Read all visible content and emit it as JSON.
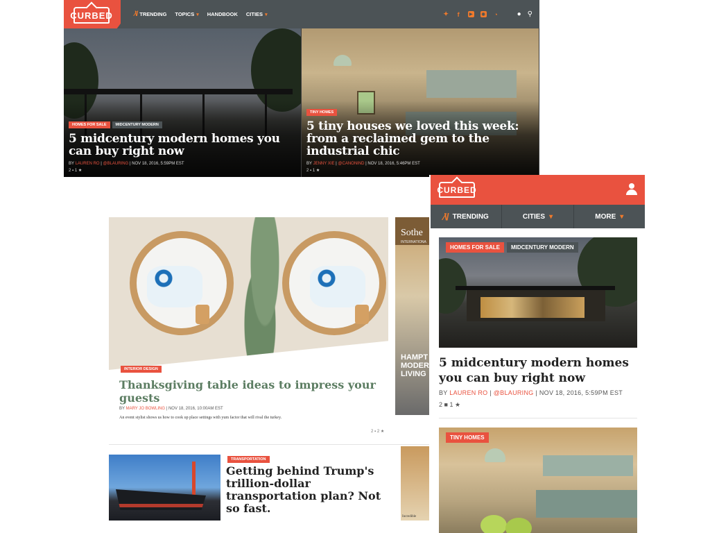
{
  "desktop": {
    "logo": "CURBED",
    "nav": [
      {
        "label": "TRENDING",
        "icon": "trending-icon"
      },
      {
        "label": "TOPICS",
        "icon": "caret-down-icon"
      },
      {
        "label": "HANDBOOK"
      },
      {
        "label": "CITIES",
        "icon": "caret-down-icon"
      }
    ],
    "social_icons": [
      "twitter-icon",
      "facebook-icon",
      "youtube-icon",
      "instagram-icon",
      "rss-icon"
    ],
    "utility_icons": [
      "user-icon",
      "search-icon"
    ],
    "stories": [
      {
        "tags": [
          "HOMES FOR SALE",
          "MIDCENTURY MODERN"
        ],
        "title": "5 midcentury modern homes you can buy right now",
        "by": "BY",
        "author": "LAUREN RO",
        "handle": "@BLAURING",
        "date": "NOV 18, 2016, 5:59PM EST",
        "comments": "2",
        "recs": "1"
      },
      {
        "tags": [
          "TINY HOMES"
        ],
        "title": "5 tiny houses we loved this week: from a reclaimed gem to the industrial chic",
        "by": "BY",
        "author": "JENNY XIE",
        "handle": "@CANONIND",
        "date": "NOV 18, 2016, 5:46PM EST",
        "comments": "2",
        "recs": "1"
      }
    ]
  },
  "tablet": {
    "story1": {
      "tag": "INTERIOR DESIGN",
      "title": "Thanksgiving table ideas to impress your guests",
      "by": "BY",
      "author": "MARY JO BOWLING",
      "date": "NOV 18, 2016, 10:00AM EST",
      "dek": "An event stylist shows us how to cook up place settings with yum factor that will rival the turkey.",
      "comments": "2",
      "recs": "2"
    },
    "ad": {
      "brand": "Sothe",
      "sub": "INTERNATIONA",
      "lines": "HAMPT MODER LIVING"
    },
    "story2": {
      "tag": "TRANSPORTATION",
      "title": "Getting behind Trump's trillion-dollar transportation plan? Not so fast."
    },
    "footer_text": "Incredible"
  },
  "mobile": {
    "logo": "CURBED",
    "nav": [
      {
        "label": "TRENDING",
        "icon": "trending-icon"
      },
      {
        "label": "CITIES",
        "icon": "caret-down-icon"
      },
      {
        "label": "MORE",
        "icon": "caret-down-icon"
      }
    ],
    "story1": {
      "tags": [
        "HOMES FOR SALE",
        "MIDCENTURY MODERN"
      ],
      "title": "5 midcentury modern homes you can buy right now",
      "by": "BY",
      "author": "LAUREN RO",
      "handle": "@BLAURING",
      "date": "NOV 18, 2016, 5:59PM EST",
      "comments": "2",
      "recs": "1"
    },
    "story2": {
      "tag": "TINY HOMES"
    }
  },
  "colors": {
    "brand": "#e9523f",
    "nav": "#4c5356",
    "accent": "#f07a2c",
    "headline_green": "#5c7d62"
  }
}
